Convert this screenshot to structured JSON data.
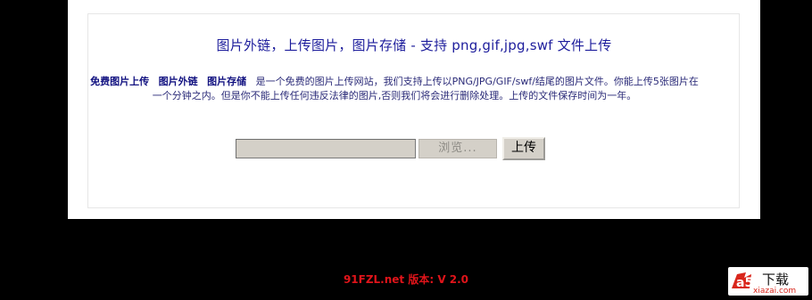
{
  "upload_page": {
    "heading": "图片外链，上传图片，图片存储 - 支持 png,gif,jpg,swf 文件上传",
    "desc_bold_1": "免费图片上传",
    "desc_bold_2": "图片外链",
    "desc_bold_3": "图片存储",
    "desc_text": "是一个免费的图片上传网站，我们支持上传以PNG/JPG/GIF/swf/结尾的图片文件。你能上传5张图片在一个分钟之内。但是你不能上传任何违反法律的图片,否则我们将会进行删除处理。上传的文件保存时间为一年。",
    "file_input_value": "",
    "browse_label": "浏览...",
    "upload_label": "上传"
  },
  "footer": {
    "version": "91FZL.net 版本: V 2.0"
  },
  "watermark": {
    "logo_text": "a5",
    "brand_text": "下载",
    "domain": "xiazai.com"
  },
  "colors": {
    "background": "#000000",
    "panel": "#ffffff",
    "heading": "#1d1d9c",
    "version": "#e0141a",
    "watermark_red": "#d9261c"
  }
}
